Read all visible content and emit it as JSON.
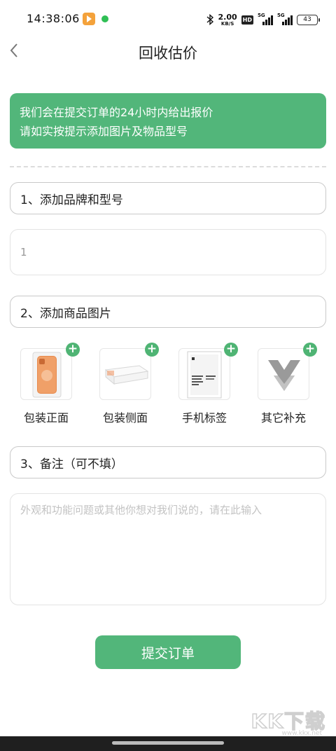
{
  "status_bar": {
    "time": "14:38:06",
    "net_speed_value": "2.00",
    "net_speed_unit": "KB/S",
    "hd_label": "HD",
    "signal1_tag": "5G",
    "signal2_tag": "5G",
    "battery": "43",
    "icons": [
      "video-app-icon",
      "chat-app-icon",
      "bluetooth-icon",
      "signal-icon",
      "battery-icon"
    ]
  },
  "header": {
    "title": "回收估价",
    "back_icon": "chevron-left-icon"
  },
  "notice": {
    "line1": "我们会在提交订单的24小时内给出报价",
    "line2": "请如实按提示添加图片及物品型号"
  },
  "sections": {
    "brand_model": {
      "label": "1、添加品牌和型号",
      "input_value": "1"
    },
    "photos": {
      "label": "2、添加商品图片",
      "items": [
        {
          "label": "包装正面",
          "icon": "phone-box-front-icon"
        },
        {
          "label": "包装侧面",
          "icon": "phone-box-side-icon"
        },
        {
          "label": "手机标签",
          "icon": "phone-label-icon"
        },
        {
          "label": "其它补充",
          "icon": "placeholder-logo-icon"
        }
      ],
      "add_symbol": "+"
    },
    "remarks": {
      "label": "3、备注（可不填）",
      "placeholder": "外观和功能问题或其他你想对我们说的，请在此输入"
    }
  },
  "submit": {
    "label": "提交订单"
  },
  "watermark": {
    "big": "KK下载",
    "small": "www.kkx.net"
  },
  "colors": {
    "accent": "#52b67a",
    "border": "#c9c9c9",
    "placeholder": "#c3c3c3"
  }
}
